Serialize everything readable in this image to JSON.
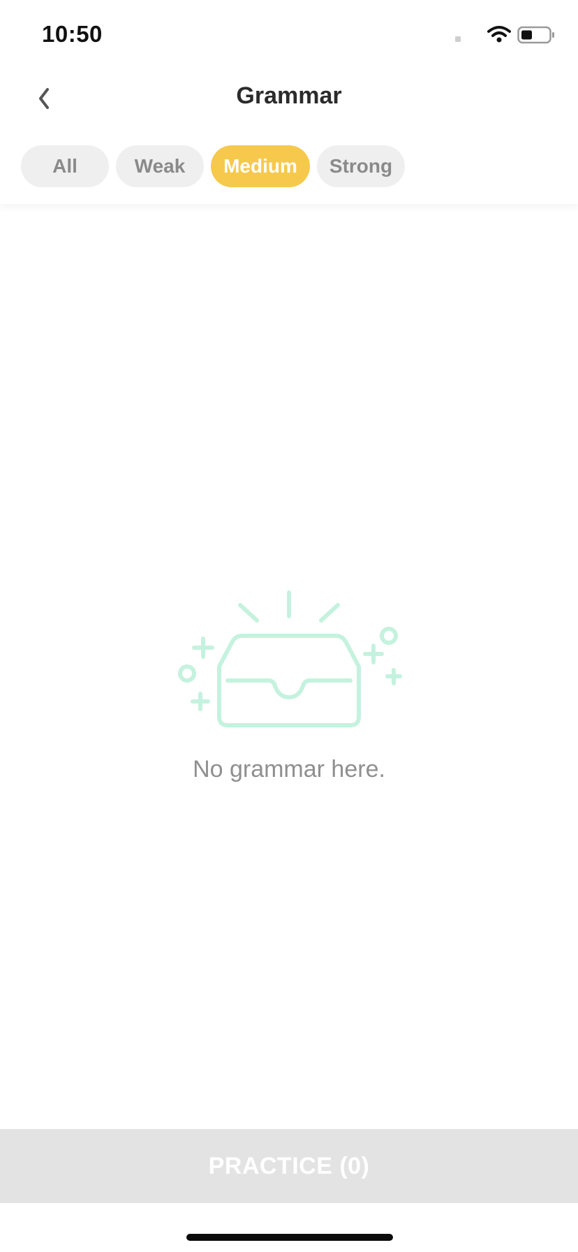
{
  "status_bar": {
    "time": "10:50",
    "icons": [
      "wifi-icon",
      "battery-icon"
    ]
  },
  "header": {
    "title": "Grammar",
    "back_icon": "chevron-left-icon"
  },
  "filters": {
    "tabs": [
      {
        "label": "All",
        "active": false
      },
      {
        "label": "Weak",
        "active": false
      },
      {
        "label": "Medium",
        "active": true
      },
      {
        "label": "Strong",
        "active": false
      }
    ],
    "active_color": "#f6c94c"
  },
  "empty_state": {
    "icon": "empty-inbox-icon",
    "message": "No grammar here.",
    "illustration_color": "#c5f2df"
  },
  "practice": {
    "label": "PRACTICE (0)"
  }
}
